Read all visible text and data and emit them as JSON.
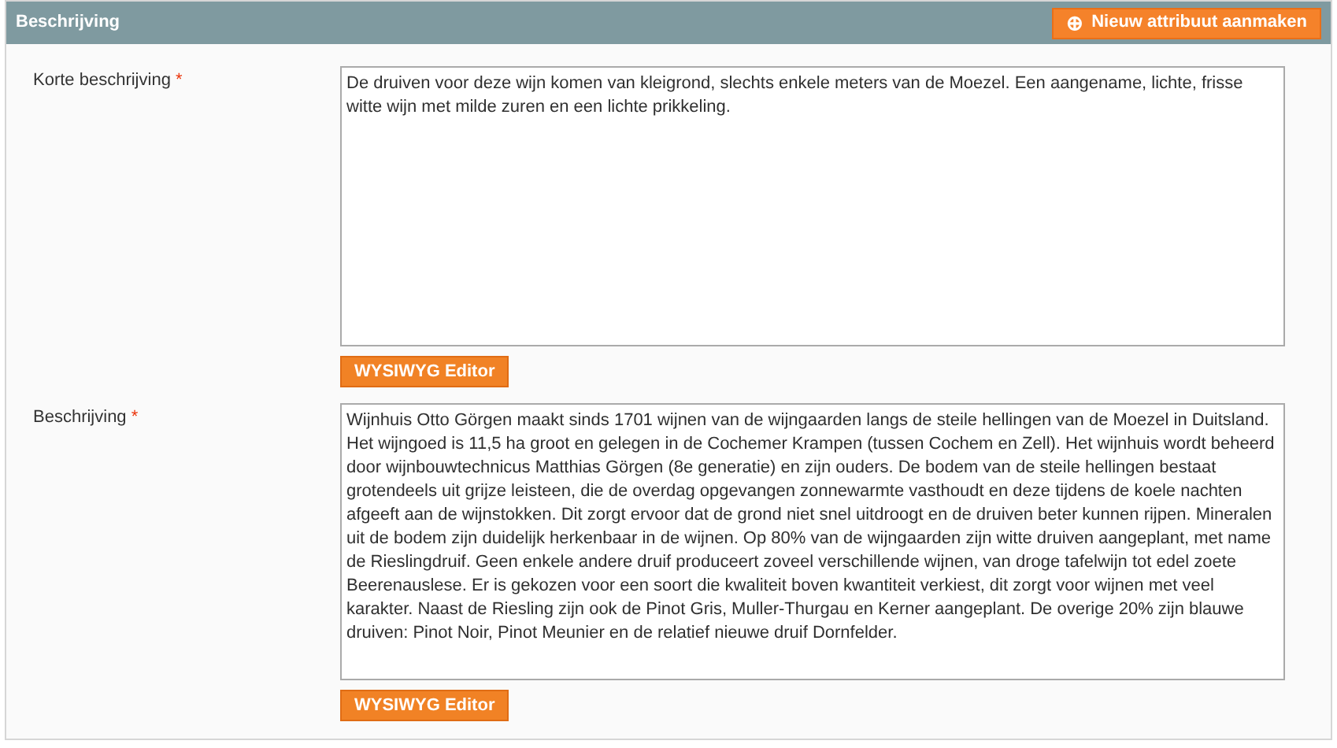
{
  "section": {
    "title": "Beschrijving",
    "action_button": {
      "icon": "⊕",
      "label": "Nieuw attribuut aanmaken"
    }
  },
  "fields": [
    {
      "label": "Korte beschrijving",
      "required_mark": "*",
      "value": "De druiven voor deze wijn komen van kleigrond, slechts enkele meters van de Moezel. Een aangename, lichte, frisse witte wijn met milde zuren en een lichte prikkeling.",
      "button": "WYSIWYG Editor"
    },
    {
      "label": "Beschrijving",
      "required_mark": "*",
      "value": "Wijnhuis Otto Görgen maakt sinds 1701 wijnen van de wijngaarden langs de steile hellingen van de Moezel in Duitsland. Het wijngoed is 11,5 ha groot en gelegen in de Cochemer Krampen (tussen Cochem en Zell). Het wijnhuis wordt beheerd door wijnbouwtechnicus Matthias Görgen (8e generatie) en zijn ouders. De bodem van de steile hellingen bestaat grotendeels uit grijze leisteen, die de overdag opgevangen zonnewarmte vasthoudt en deze tijdens de koele nachten afgeeft aan de wijnstokken. Dit zorgt ervoor dat de grond niet snel uitdroogt en de druiven beter kunnen rijpen. Mineralen uit de bodem zijn duidelijk herkenbaar in de wijnen. Op 80% van de wijngaarden zijn witte druiven aangeplant, met name de Rieslingdruif. Geen enkele andere druif produceert zoveel verschillende wijnen, van droge tafelwijn tot edel zoete Beerenauslese. Er is gekozen voor een soort die kwaliteit boven kwantiteit verkiest, dit zorgt voor wijnen met veel karakter. Naast de Riesling zijn ook de Pinot Gris, Muller-Thurgau en Kerner aangeplant. De overige 20% zijn blauwe druiven: Pinot Noir, Pinot Meunier en de relatief nieuwe druif Dornfelder.",
      "button": "WYSIWYG Editor"
    }
  ]
}
